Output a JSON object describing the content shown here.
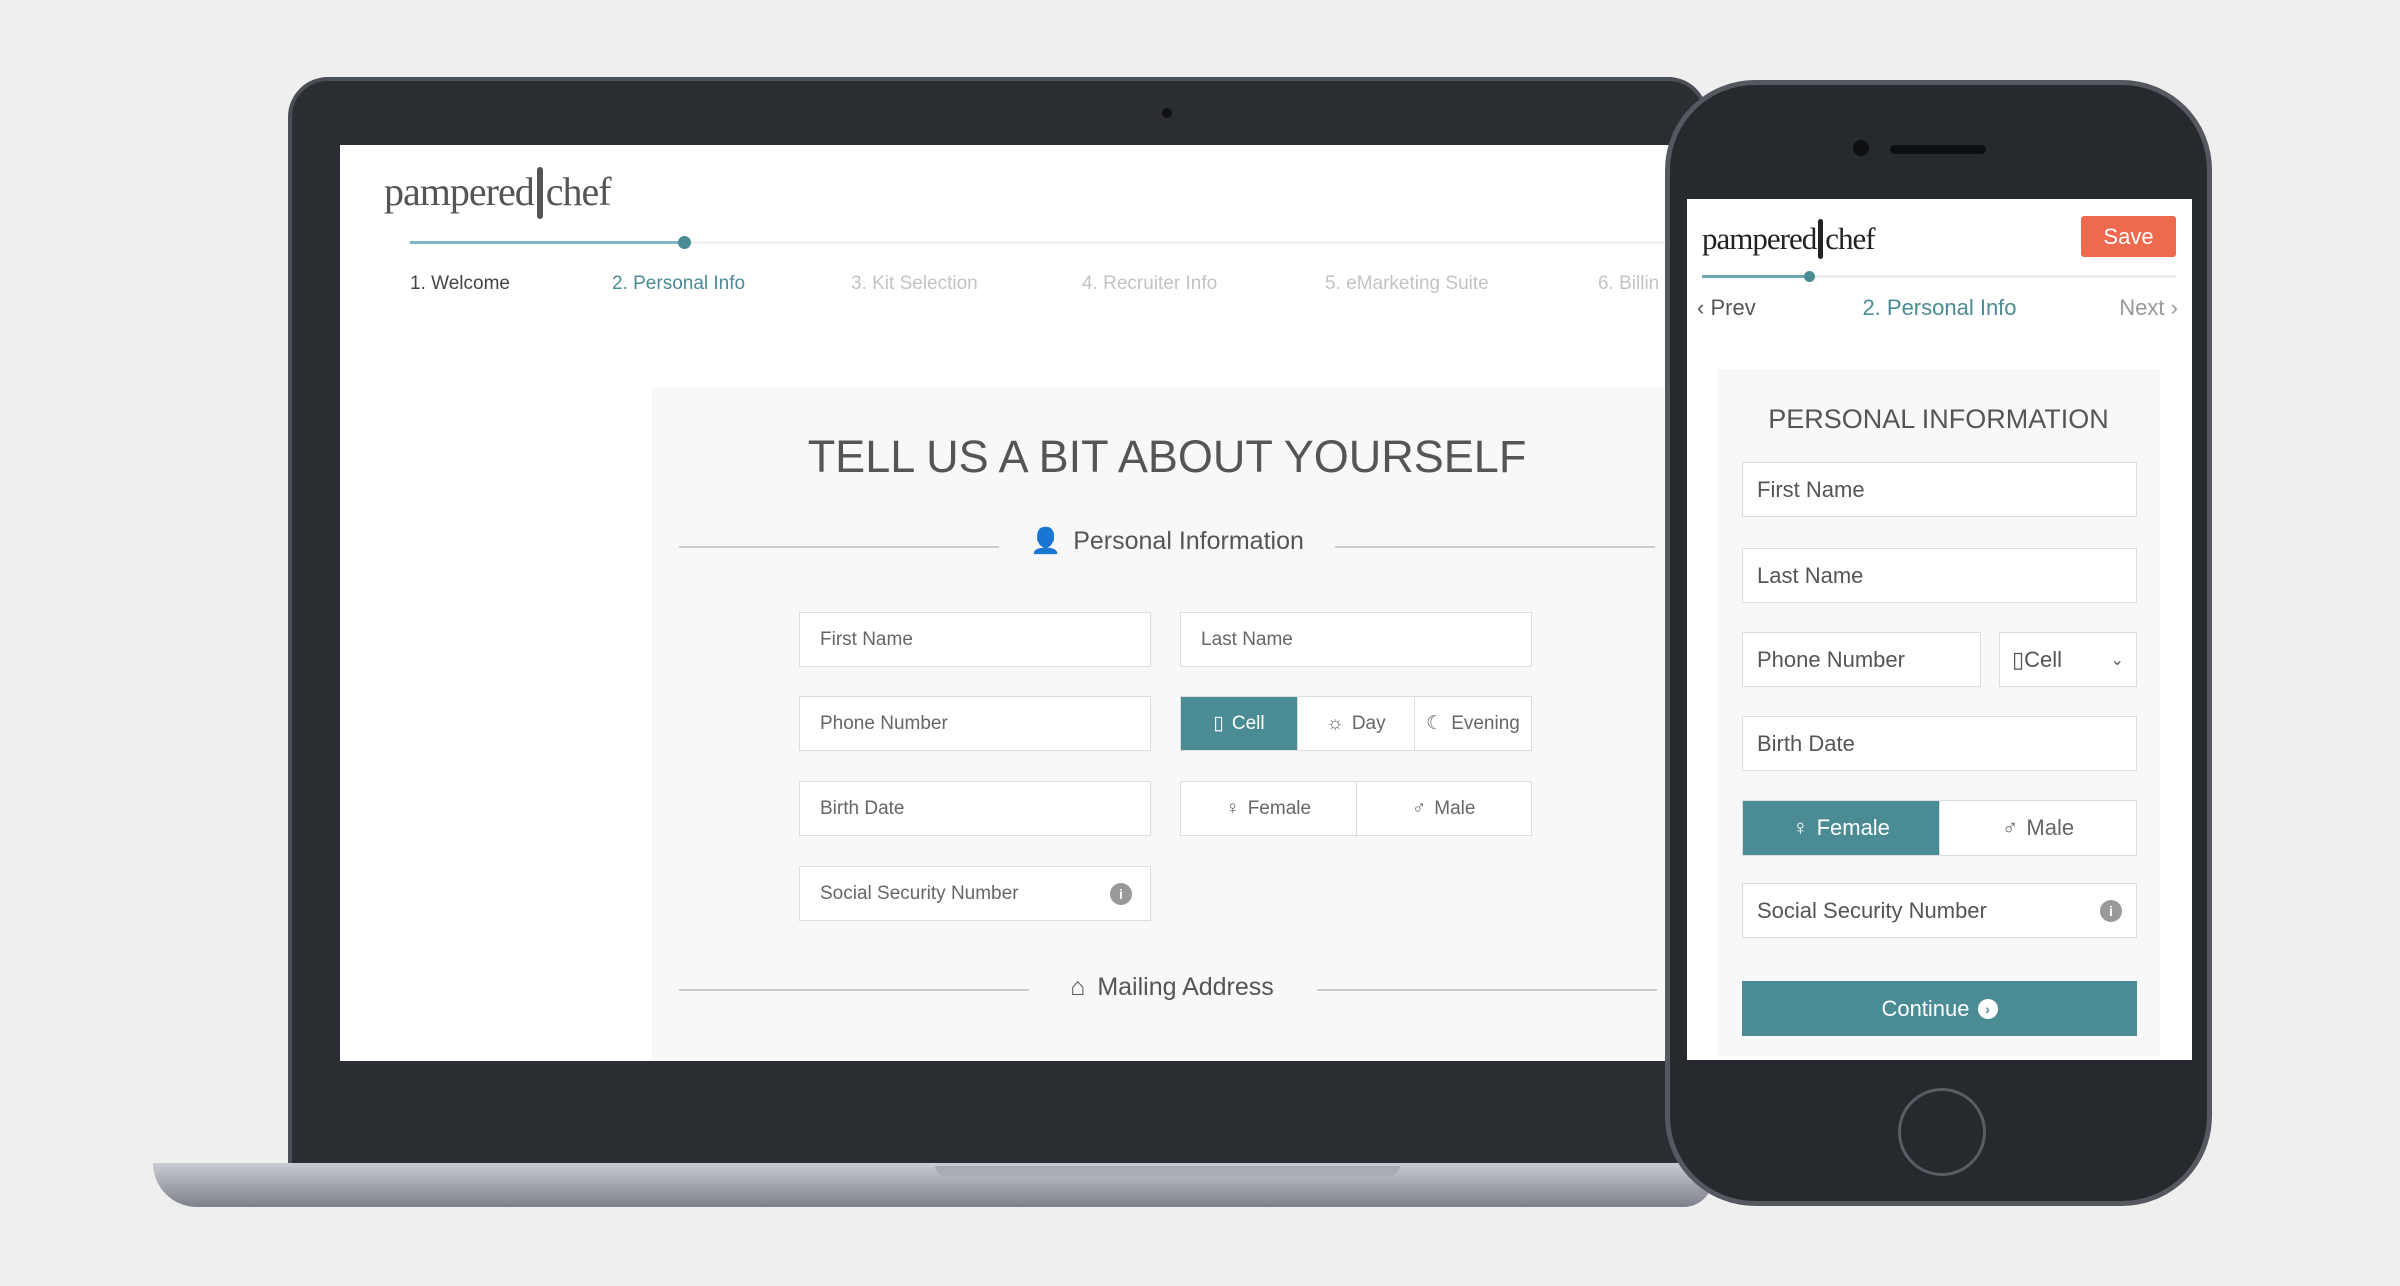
{
  "brand": {
    "logo_text_left": "pampered",
    "logo_text_right": "chef"
  },
  "laptop": {
    "tabs": [
      {
        "label": "1. Welcome",
        "state": "done"
      },
      {
        "label": "2. Personal Info",
        "state": "active"
      },
      {
        "label": "3. Kit Selection",
        "state": "todo"
      },
      {
        "label": "4. Recruiter Info",
        "state": "todo"
      },
      {
        "label": "5. eMarketing Suite",
        "state": "todo"
      },
      {
        "label": "6. Billin",
        "state": "todo"
      }
    ],
    "progress_percent": 22,
    "title": "TELL US A BIT ABOUT YOURSELF",
    "section_personal": "Personal Information",
    "fields": {
      "first_name": "First Name",
      "last_name": "Last Name",
      "phone": "Phone Number",
      "birth_date": "Birth Date",
      "ssn": "Social Security Number"
    },
    "phone_type": {
      "options": [
        "Cell",
        "Day",
        "Evening"
      ],
      "selected": "Cell"
    },
    "gender": {
      "options": [
        "Female",
        "Male"
      ],
      "selected": null
    },
    "section_address": "Mailing Address"
  },
  "phone": {
    "save_label": "Save",
    "prev_label": "Prev",
    "current_step": "2. Personal Info",
    "next_label": "Next",
    "steps_total": 7,
    "steps_done": 2,
    "title": "PERSONAL INFORMATION",
    "fields": {
      "first_name": "First Name",
      "last_name": "Last Name",
      "phone": "Phone Number",
      "birth_date": "Birth Date",
      "ssn": "Social Security Number"
    },
    "phone_type_selected": "Cell",
    "gender": {
      "options": [
        "Female",
        "Male"
      ],
      "selected": "Female"
    },
    "continue_label": "Continue"
  },
  "colors": {
    "accent": "#4a8b94",
    "save": "#ee6a4e",
    "background": "#efefef"
  }
}
